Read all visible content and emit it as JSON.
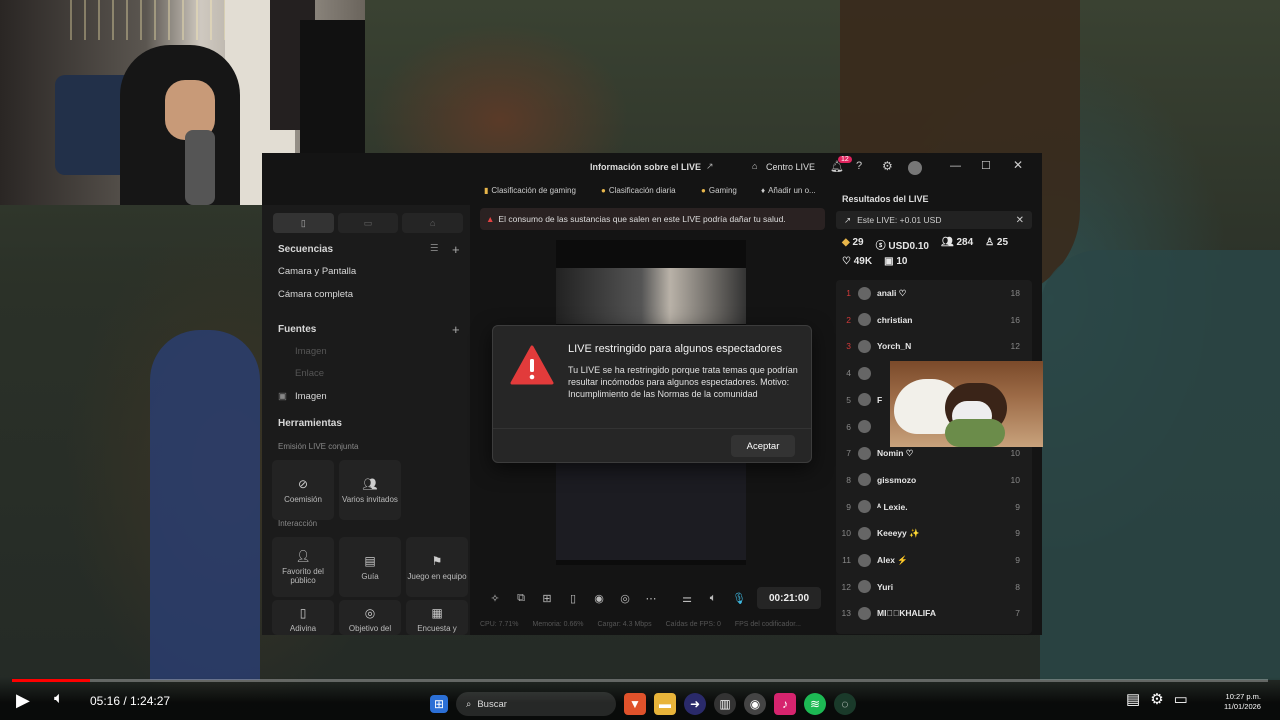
{
  "app": {
    "title": "Información sobre el LIVE",
    "centro": "Centro LIVE",
    "notif": "12"
  },
  "chips": [
    "Clasificación de gaming",
    "Clasificación diaria",
    "Gaming",
    "Añadir un o..."
  ],
  "warning": "El consumo de las sustancias que salen en este LIVE podría dañar tu salud.",
  "left": {
    "secuencias": "Secuencias",
    "items": [
      "Camara y Pantalla",
      "Cámara completa"
    ],
    "fuentes": "Fuentes",
    "fuente_items": [
      "Imagen",
      "Enlace",
      "Imagen"
    ],
    "herramientas": "Herramientas",
    "emision": "Emisión LIVE conjunta",
    "tools1": [
      "Coemisión",
      "Varios invitados"
    ],
    "interaccion": "Interacción",
    "tools2": [
      "Favorito del público",
      "Guía",
      "Juego en equipo"
    ],
    "tools3": [
      "Adivina",
      "Objetivo del",
      "Encuesta y"
    ]
  },
  "dialog": {
    "title": "LIVE restringido para algunos espectadores",
    "body": "Tu LIVE se ha restringido porque trata temas que podrían resultar incómodos para algunos espectadores. Motivo: Incumplimiento de las Normas de la comunidad",
    "button": "Aceptar"
  },
  "controls": {
    "timer": "00:21:00"
  },
  "stats": [
    "CPU: 7.71%",
    "Memoria: 0.66%",
    "Cargar: 4.3 Mbps",
    "Caídas de FPS: 0",
    "FPS del codificador..."
  ],
  "results": {
    "title": "Resultados del LIVE",
    "este": "Este LIVE: +0.01 USD",
    "s1": [
      "29",
      "USD0.10",
      "284",
      "25"
    ],
    "s2": [
      "49K",
      "10"
    ],
    "rows": [
      {
        "rank": "1",
        "name": "anali ♡",
        "score": "18"
      },
      {
        "rank": "2",
        "name": "christian",
        "score": "16"
      },
      {
        "rank": "3",
        "name": "Yorch_N",
        "score": "12"
      },
      {
        "rank": "4",
        "name": "",
        "score": ""
      },
      {
        "rank": "5",
        "name": "F",
        "score": ""
      },
      {
        "rank": "6",
        "name": "",
        "score": ""
      },
      {
        "rank": "7",
        "name": "Nomin ♡",
        "score": "10"
      },
      {
        "rank": "8",
        "name": "gissmozo",
        "score": "10"
      },
      {
        "rank": "9",
        "name": "ᴬ Lexie.",
        "score": "9"
      },
      {
        "rank": "10",
        "name": "Keeeyy ✨",
        "score": "9"
      },
      {
        "rank": "11",
        "name": "Alex ⚡",
        "score": "9"
      },
      {
        "rank": "12",
        "name": "Yuri",
        "score": "8"
      },
      {
        "rank": "13",
        "name": "MI⃝⃝KHALIFA",
        "score": "7"
      }
    ]
  },
  "player": {
    "time": "05:16 / 1:24:27",
    "progress": 0.062
  },
  "taskbar": {
    "search": "Buscar",
    "time": "10:27 p.m.",
    "date": "11/01/2026"
  }
}
